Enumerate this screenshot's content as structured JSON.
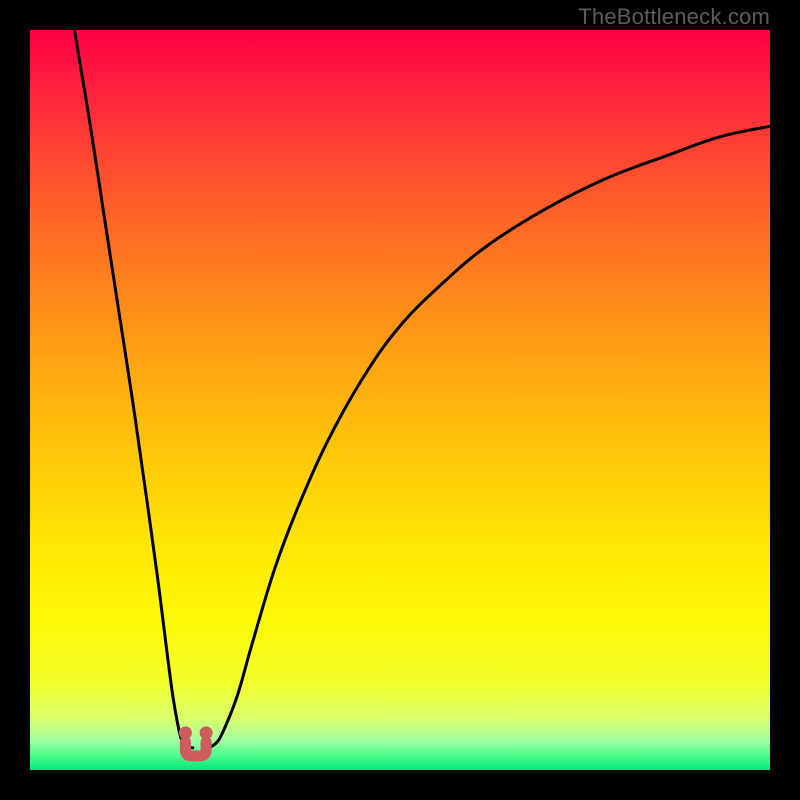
{
  "watermark": "TheBottleneck.com",
  "chart_data": {
    "type": "line",
    "title": "",
    "xlabel": "",
    "ylabel": "",
    "x_range": [
      0,
      100
    ],
    "y_range": [
      0,
      100
    ],
    "grid": false,
    "series": [
      {
        "name": "left-branch",
        "x": [
          6,
          8,
          10,
          12,
          14,
          16,
          17.5,
          18.5,
          19.3,
          20,
          20.5,
          21,
          22
        ],
        "y": [
          100,
          88,
          75,
          62,
          49,
          35,
          24,
          16,
          10,
          6,
          4,
          3.2,
          3.0
        ]
      },
      {
        "name": "right-branch",
        "x": [
          24,
          25,
          26,
          28,
          30,
          33,
          36,
          40,
          45,
          50,
          56,
          62,
          70,
          78,
          86,
          93,
          100
        ],
        "y": [
          3.0,
          3.5,
          5,
          10,
          17,
          27,
          35,
          44,
          53,
          60,
          66,
          71,
          76,
          80,
          83,
          85.5,
          87
        ]
      }
    ],
    "markers": [
      {
        "name": "valley-pin-left",
        "x": 21.0,
        "y": 3.8
      },
      {
        "name": "valley-pin-right",
        "x": 23.8,
        "y": 3.8
      }
    ],
    "marker_color": "#cd5c5c",
    "curve_color": "#000000",
    "curve_width": 3
  },
  "colors": {
    "background": "#000000",
    "watermark": "#5c5c5c"
  }
}
